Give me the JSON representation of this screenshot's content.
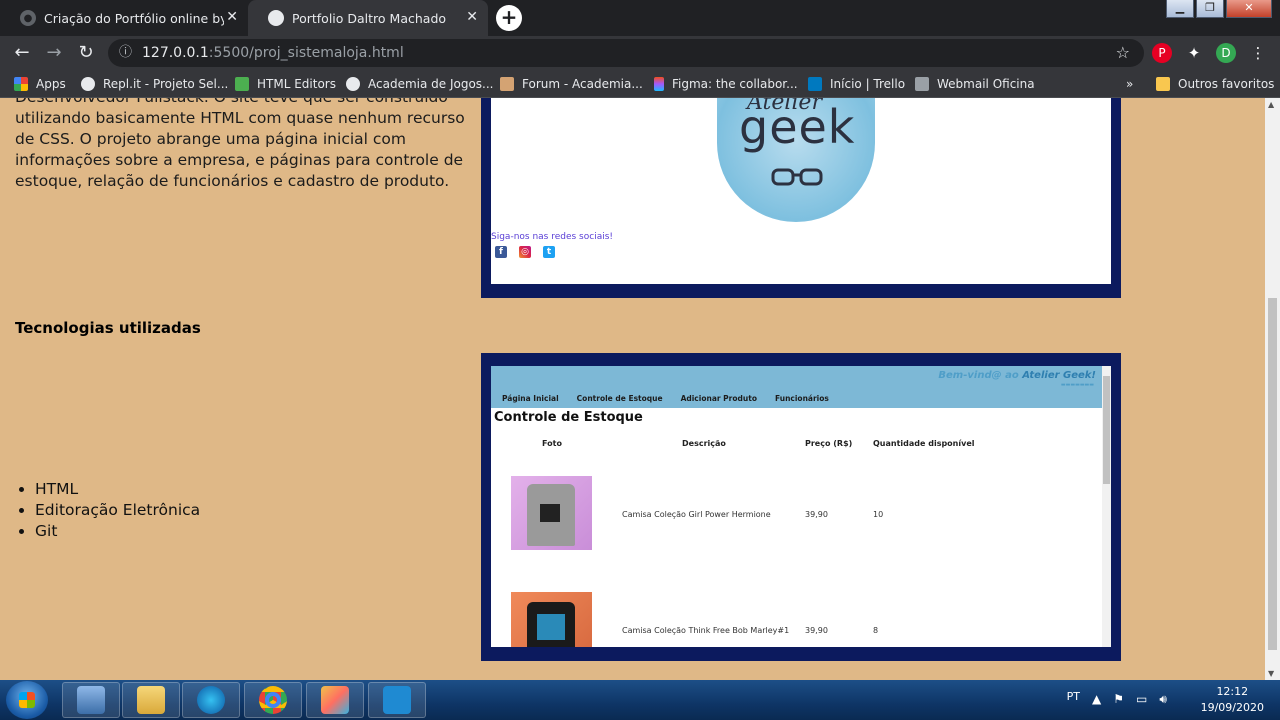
{
  "browser": {
    "tabs": [
      {
        "title": "Criação do Portfólio online by da",
        "active": false
      },
      {
        "title": "Portfolio Daltro Machado",
        "active": true
      }
    ],
    "url_host": "127.0.0.1",
    "url_path": ":5500/proj_sistemaloja.html",
    "bookmarks": [
      {
        "label": "Apps",
        "color": "#e37400"
      },
      {
        "label": "Repl.it - Projeto Sel...",
        "color": "#f26207"
      },
      {
        "label": "HTML Editors",
        "color": "#4caf50"
      },
      {
        "label": "Academia de Jogos...",
        "color": "#e8eaed"
      },
      {
        "label": "Forum - Academia...",
        "color": "#d4a373"
      },
      {
        "label": "Figma: the collabor...",
        "color": "#a259ff"
      },
      {
        "label": "Início | Trello",
        "color": "#0079bf"
      },
      {
        "label": "Webmail Oficina",
        "color": "#9aa0a6"
      },
      {
        "label": "Outros favoritos",
        "color": "#f9c74f"
      }
    ],
    "profile_initial": "D"
  },
  "page": {
    "description": "Desenvolvedor Fullstack. O site teve que ser construído utilizando basicamente HTML com quase nenhum recurso de CSS. O projeto abrange uma página inicial com informações sobre a empresa, e páginas para controle de estoque, relação de funcionários e cadastro de produto.",
    "tech_title": "Tecnologias utilizadas",
    "technologies": [
      "HTML",
      "Editoração Eletrônica",
      "Git"
    ]
  },
  "preview1": {
    "logo_top": "Atelier",
    "logo_main": "geek",
    "social_text": "Siga-nos nas redes sociais!"
  },
  "preview2": {
    "welcome_prefix": "Bem-vind@ ao",
    "welcome_brand": "Atelier Geek!",
    "nav": [
      "Página Inicial",
      "Controle de Estoque",
      "Adicionar Produto",
      "Funcionários"
    ],
    "heading": "Controle de Estoque",
    "columns": [
      "Foto",
      "Descrição",
      "Preço (R$)",
      "Quantidade disponível"
    ],
    "rows": [
      {
        "description": "Camisa Coleção Girl Power Hermione",
        "price": "39,90",
        "qty": "10"
      },
      {
        "description": "Camisa Coleção Think Free Bob Marley#1",
        "price": "39,90",
        "qty": "8"
      }
    ]
  },
  "taskbar": {
    "lang": "PT",
    "time": "12:12",
    "date": "19/09/2020"
  }
}
